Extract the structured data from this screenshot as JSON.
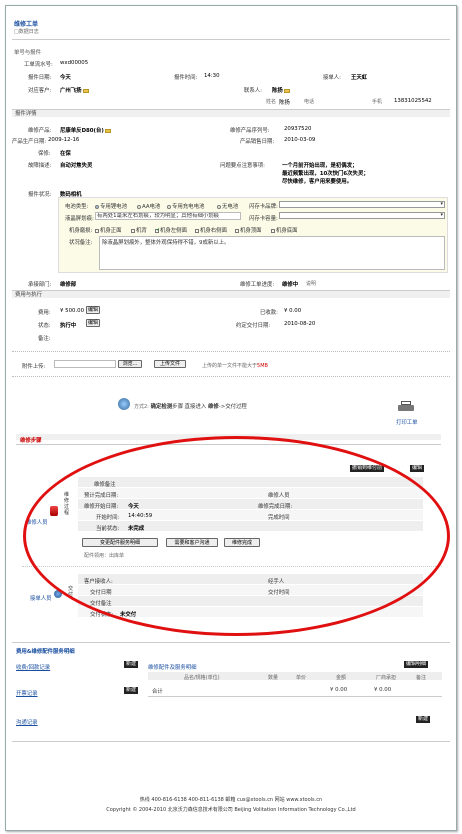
{
  "header": {
    "title": "维修工单",
    "subtitle": "□数据日志"
  },
  "sections": {
    "order_request": "单号与报件",
    "details": "报件详情",
    "fees": "费用与执行",
    "fees_materials": "费用&维修配件服务明细"
  },
  "order": {
    "id_label": "工单流水号:",
    "id_value": "wxd00005",
    "report_date_label": "报件日期:",
    "report_date_value": "今天",
    "report_time_label": "报件时间:",
    "report_time_value": "14:30",
    "receiver_label": "接单人:",
    "receiver_value": "王天虹",
    "customer_label": "对应客户:",
    "customer_value": "广州飞扬",
    "contact_label": "联系人:",
    "contact_value": "陈扬",
    "name_label": "姓名",
    "name_value": "陈扬",
    "phone_label": "电话",
    "mobile_label": "手机",
    "mobile_value": "13831025542"
  },
  "product": {
    "product_label": "维修产品:",
    "product_value": "尼康单反D80(台)",
    "serial_label": "维修产品序列号:",
    "serial_value": "20937520",
    "mfg_date_label": "产品生产日期:",
    "mfg_date_value": "2009-12-16",
    "sale_date_label": "产品销售日期:",
    "sale_date_value": "2010-03-09",
    "warranty_label": "保修:",
    "warranty_value": "在保",
    "fault_label": "故障描述:",
    "fault_value": "自动对焦失灵",
    "note_label": "问题要点注意事项:",
    "note_lines": [
      "一个月前开始出现，是初偶发；",
      "最近频繁出现，10次快门6次失灵；",
      "尽快维修，客户用来要使用。"
    ],
    "status_label": "报件状况:",
    "status_value": "数码相机",
    "battery_label": "电池类型:",
    "battery_options": [
      "专用锂电池",
      "AA电池",
      "专用充电电池",
      "无电池"
    ],
    "screen_label": "液晶屏划痕:",
    "screen_value": "有两处1毫米左右划痕，较为明显；其他有细小划痕",
    "memory_card_label": "闪存卡品牌:",
    "memory_size_label": "闪存卡容量:",
    "body_wear_label": "机身磨损:",
    "body_wear_options": [
      "机身正面",
      "机背",
      "机身左侧面",
      "机身右侧面",
      "机身顶面",
      "机身底面"
    ],
    "status_desc_label": "状况备注:",
    "status_desc_value": "除液晶屏划痕外，整体外观保持得不错，9成新以上。",
    "dept_label": "承接部门:",
    "dept_value": "维修部",
    "progress_label": "维修工单进度:",
    "progress_value": "维修中",
    "progress_note": "说明"
  },
  "fees": {
    "fee_label": "费用:",
    "fee_value": "¥ 500.00",
    "fee_btn": "编辑",
    "received_label": "已收款:",
    "received_value": "¥ 0.00",
    "state_label": "状态:",
    "state_value": "执行中",
    "state_btn": "编辑",
    "deliver_label": "约定交付日期:",
    "deliver_value": "2010-08-20",
    "remark_label": "备注:"
  },
  "upload": {
    "label": "附件上传:",
    "browse": "浏览...",
    "upload_btn": "上传文件",
    "hint": "上传的单一文件不能大于",
    "hint_size": "5MB"
  },
  "method": {
    "text_prefix": "方式2:",
    "text_bold": "确定检测",
    "text_mid": "步骤 直接进入",
    "text_bold2": "维修",
    "text_end": "->交付过程",
    "print": "打印工单"
  },
  "repair": {
    "title": "维修步骤",
    "btn_return": "撤销到维付前",
    "btn_edit": "编辑",
    "person_caption": "维修人员",
    "person_label": "维修人员",
    "note_label": "维修备注",
    "plan_date_label": "预计完成日期:",
    "start_date_label": "维修开始日期:",
    "start_date_value": "今天",
    "finish_date_label": "维修完成日期:",
    "start_time_label": "开始时间:",
    "start_time_value": "14:40:59",
    "finish_time_label": "完成时间",
    "state_label": "当前状态:",
    "state_value": "未完成",
    "btn_change": "变更配件服务明细",
    "btn_contact": "需要和客户沟通",
    "btn_done": "维修完成",
    "parts_label": "配件领用：出库单"
  },
  "delivery": {
    "caption": "接单人员",
    "side_label": "交付",
    "receiver_label": "客户接收人:",
    "handler_label": "经手人",
    "date_label": "交付日期",
    "time_label": "交付时间",
    "note_label": "交付备注",
    "state_label": "交付状态:",
    "state_value": "未交付"
  },
  "bottom": {
    "payment_link": "收费/回款记录",
    "payment_btn": "新建",
    "parts_title": "维修配件及服务明细",
    "parts_btn": "编辑明细",
    "cols": [
      "品名/规格(单位)",
      "数量",
      "单价",
      "金额",
      "厂商承担",
      "备注"
    ],
    "total_label": "合计",
    "total_amount": "¥ 0.00",
    "total_vendor": "¥ 0.00",
    "invoice_link": "开票记录",
    "invoice_btn": "新建",
    "comm_link": "沟通记录",
    "comm_btn": "新建"
  },
  "footer": {
    "line1": "热线 400-816-6138  400-811-6138  邮箱 cus@xtools.cn  网站 www.xtools.cn",
    "line2": "Copyright © 2004-2010 北京沃力森信息技术有限公司 Beijing Volitation Information Technology Co.,Ltd"
  }
}
